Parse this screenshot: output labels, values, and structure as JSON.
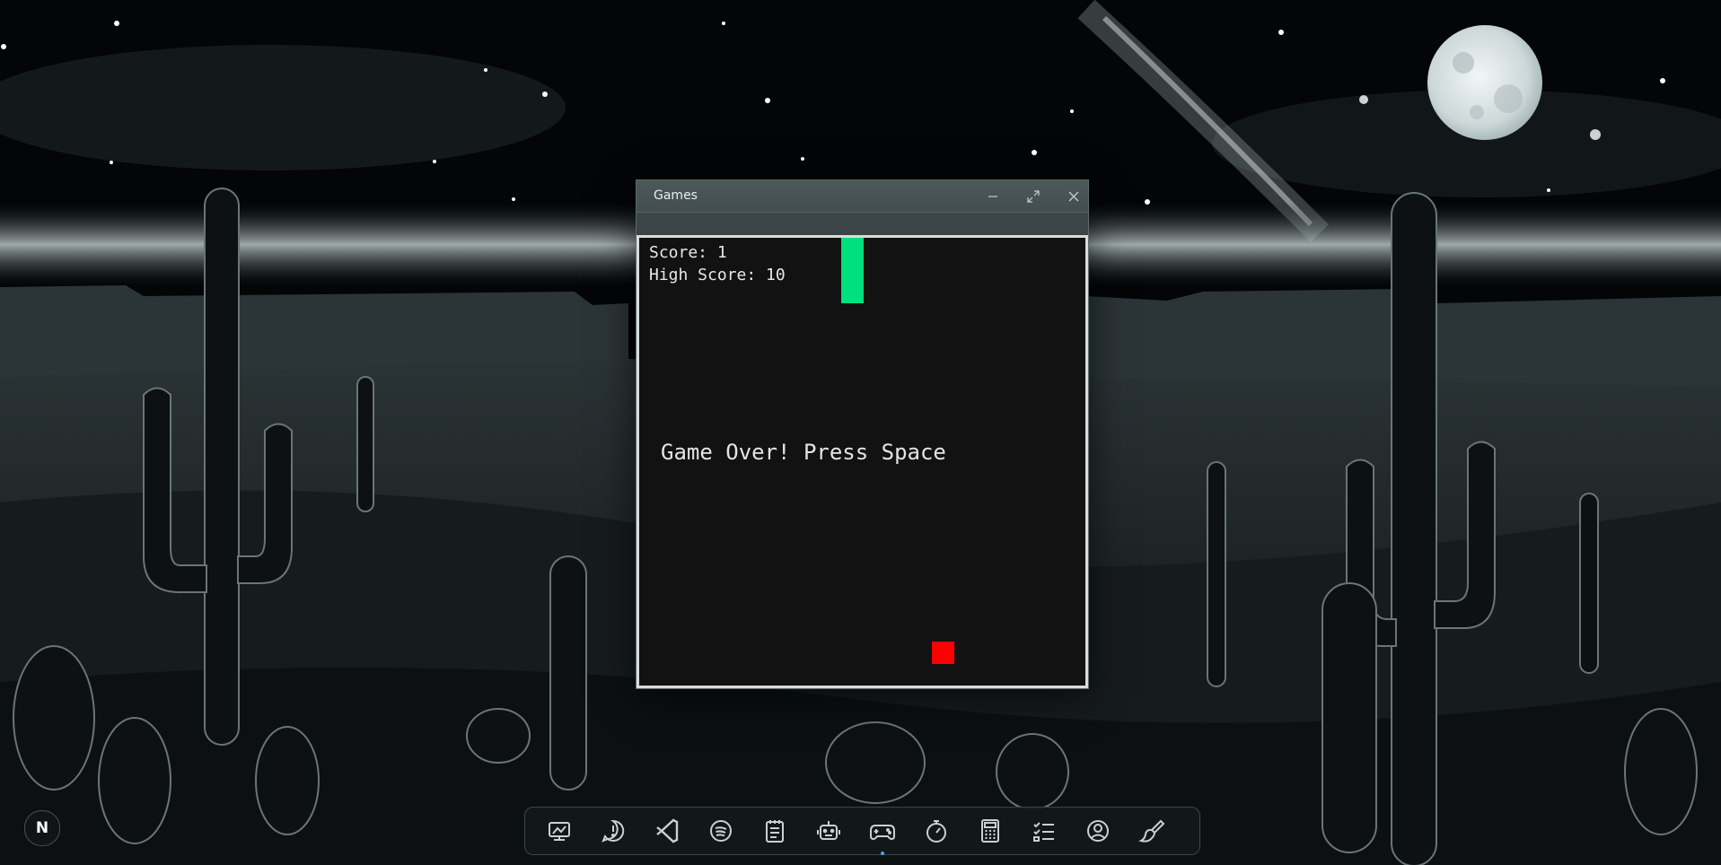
{
  "window": {
    "title": "Games",
    "minimize_icon": "minimize-icon",
    "maximize_icon": "maximize-icon",
    "close_icon": "close-icon"
  },
  "game": {
    "score_text": "Score: 1",
    "high_score_text": "High Score: 10",
    "message": "Game Over! Press Space",
    "paddle_color": "#00e07c",
    "ball_color": "#ff0000",
    "canvas_color": "#121212"
  },
  "start": {
    "label": "N"
  },
  "dock": {
    "items": [
      "screen-settings-icon",
      "feedback-icon",
      "code-editor-icon",
      "spotify-icon",
      "notepad-icon",
      "robot-icon",
      "gamepad-icon",
      "stopwatch-icon",
      "calculator-icon",
      "checklist-icon",
      "profile-icon",
      "paint-brush-icon"
    ],
    "active": "gamepad-icon"
  }
}
